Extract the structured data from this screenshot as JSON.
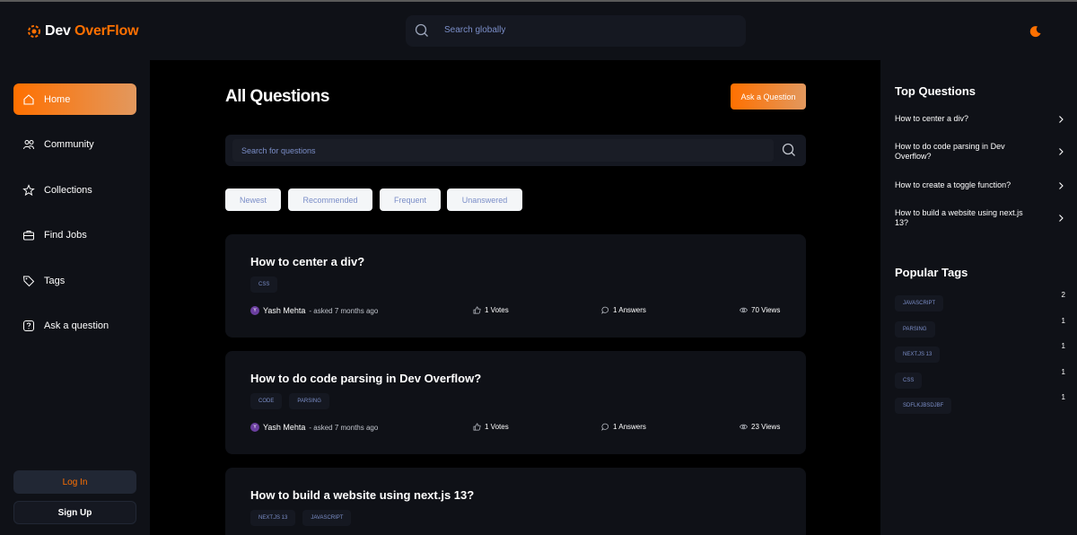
{
  "app": {
    "logo_text_white": "Dev",
    "logo_text_orange": "OverFlow",
    "accent": "#ff7000"
  },
  "header": {
    "search_placeholder": "Search globally",
    "search_icon": "search-icon",
    "theme_icon": "moon-icon"
  },
  "sidebar": {
    "items": [
      {
        "label": "Home",
        "icon": "home-icon",
        "active": true
      },
      {
        "label": "Community",
        "icon": "users-icon",
        "active": false
      },
      {
        "label": "Collections",
        "icon": "star-icon",
        "active": false
      },
      {
        "label": "Find Jobs",
        "icon": "briefcase-icon",
        "active": false
      },
      {
        "label": "Tags",
        "icon": "tag-icon",
        "active": false
      },
      {
        "label": "Ask a question",
        "icon": "question-icon",
        "active": false
      }
    ],
    "login_label": "Log In",
    "signup_label": "Sign Up"
  },
  "main": {
    "title": "All Questions",
    "ask_button": "Ask a Question",
    "search_placeholder": "Search for questions",
    "filters": [
      "Newest",
      "Recommended",
      "Frequent",
      "Unanswered"
    ],
    "questions": [
      {
        "title": "How to center a div?",
        "tags": [
          "css"
        ],
        "author": "Yash Mehta",
        "avatar_letter": "Y",
        "asked": "- asked 7 months ago",
        "votes": "1 Votes",
        "answers": "1 Answers",
        "views": "70 Views"
      },
      {
        "title": "How to do code parsing in Dev Overflow?",
        "tags": [
          "code",
          "parsing"
        ],
        "author": "Yash Mehta",
        "avatar_letter": "Y",
        "asked": "- asked 7 months ago",
        "votes": "1 Votes",
        "answers": "1 Answers",
        "views": "23 Views"
      },
      {
        "title": "How to build a website using next.js 13?",
        "tags": [
          "next.js 13",
          "javascript"
        ]
      }
    ]
  },
  "right": {
    "top_questions_title": "Top Questions",
    "top_questions": [
      "How to center a div?",
      "How to do code parsing in Dev Overflow?",
      "How to create a toggle function?",
      "How to build a website using next.js 13?"
    ],
    "popular_tags_title": "Popular Tags",
    "popular_tags": [
      {
        "name": "javascript",
        "count": "2"
      },
      {
        "name": "parsing",
        "count": "1"
      },
      {
        "name": "next.js 13",
        "count": "1"
      },
      {
        "name": "css",
        "count": "1"
      },
      {
        "name": "sdflkjbsdjbf",
        "count": "1"
      }
    ]
  }
}
